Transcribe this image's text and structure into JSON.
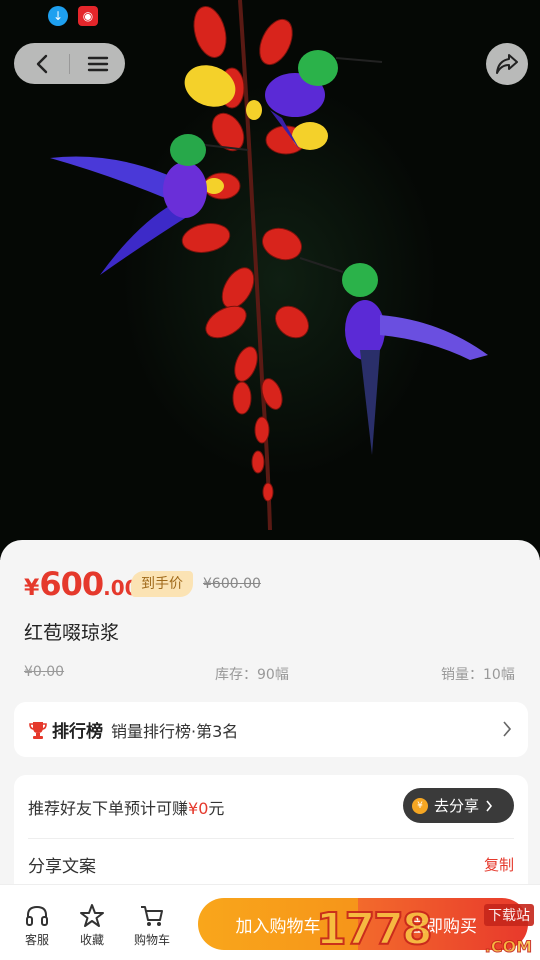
{
  "product": {
    "price_currency": "¥",
    "price_int": "600",
    "price_dec": ".00",
    "price_badge": "到手价",
    "original_price": "¥600.00",
    "title": "红苞啜琼浆",
    "market_price": "¥0.00",
    "stock": "库存：90幅",
    "sales": "销量：10幅"
  },
  "ranking": {
    "logo_text": "排行榜",
    "label": "销量排行榜·第3名"
  },
  "share": {
    "prefix": "推荐好友下单预计可赚",
    "amount": "¥0",
    "suffix": "元",
    "go_label": "去分享",
    "copy_title": "分享文案",
    "copy_label": "复制"
  },
  "bottom_bar": {
    "service_label": "客服",
    "favorite_label": "收藏",
    "cart_label": "购物车",
    "add_to_cart": "加入购物车",
    "buy_now": "立即购买"
  },
  "watermark": {
    "number": "1778",
    "download_text": "下载站",
    "domain": ".COM"
  },
  "colors": {
    "accent": "#e5392c",
    "cart_button": "#f9a61b",
    "badge_bg": "#fbe3b4"
  }
}
